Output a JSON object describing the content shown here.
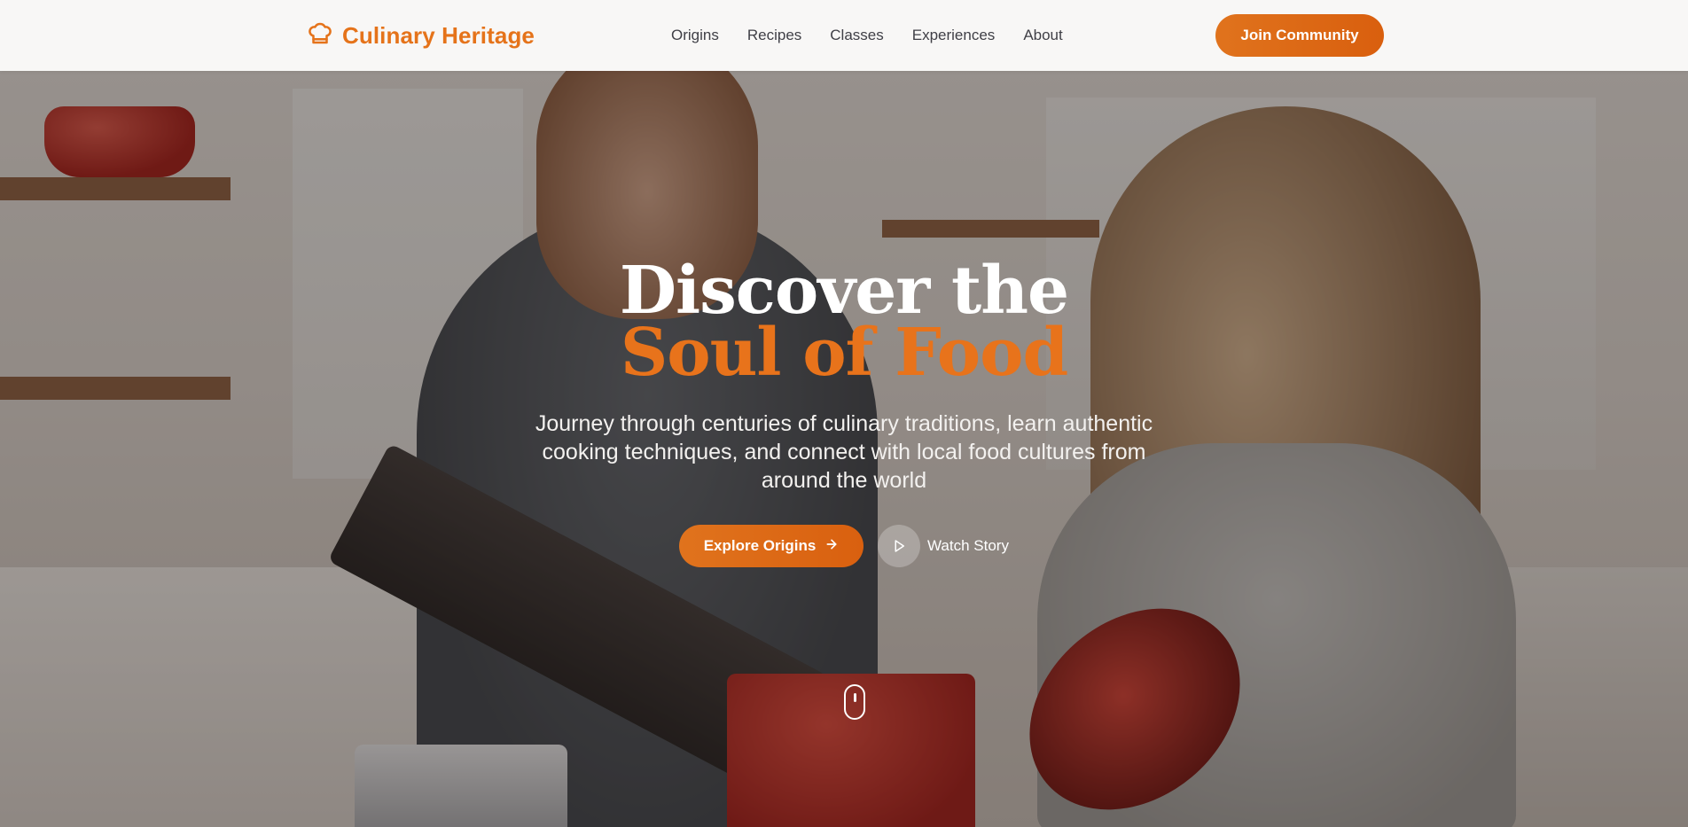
{
  "brand": {
    "name": "Culinary Heritage",
    "icon": "chef-hat-icon",
    "color": "#e5731a"
  },
  "nav": {
    "items": [
      {
        "label": "Origins"
      },
      {
        "label": "Recipes"
      },
      {
        "label": "Classes"
      },
      {
        "label": "Experiences"
      },
      {
        "label": "About"
      }
    ],
    "join_label": "Join Community"
  },
  "hero": {
    "title_line1": "Discover the",
    "title_line2": "Soul of Food",
    "subtitle": "Journey through centuries of culinary traditions, learn authentic cooking techniques, and connect with local food cultures from around the world",
    "primary_cta": {
      "label": "Explore Origins",
      "icon": "arrow-right-icon"
    },
    "secondary_cta": {
      "label": "Watch Story",
      "icon": "play-icon"
    },
    "scroll_indicator": "mouse-scroll-icon",
    "background": "photo of two people cooking in a kitchen"
  },
  "colors": {
    "accent": "#e5731a",
    "accent_dark": "#d95f0e",
    "text_dark": "#3f3f46",
    "header_bg": "#f8f7f6"
  }
}
